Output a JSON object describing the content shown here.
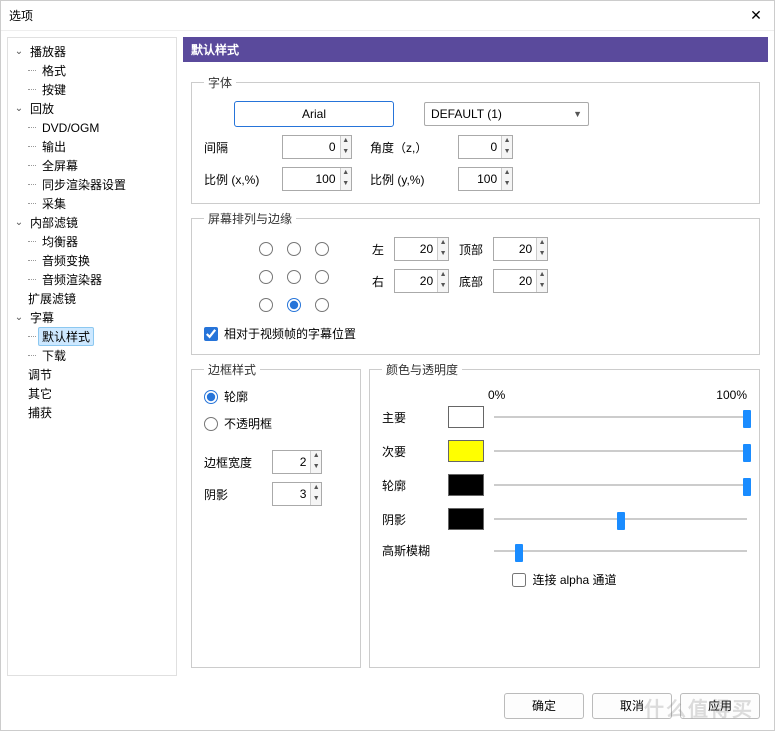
{
  "window": {
    "title": "选项",
    "close": "✕"
  },
  "tree": {
    "items": [
      {
        "label": "播放器",
        "exp": true,
        "children": [
          "格式",
          "按键"
        ]
      },
      {
        "label": "回放",
        "exp": true,
        "children": [
          "DVD/OGM",
          "输出",
          "全屏幕",
          "同步渲染器设置",
          "采集"
        ]
      },
      {
        "label": "内部滤镜",
        "exp": true,
        "children": [
          "均衡器",
          "音频变换",
          "音频渲染器"
        ]
      },
      {
        "label": "扩展滤镜",
        "exp": false,
        "children": []
      },
      {
        "label": "字幕",
        "exp": true,
        "children": [
          "默认样式",
          "下载"
        ],
        "selected": "默认样式"
      },
      {
        "label": "调节",
        "exp": false,
        "children": []
      },
      {
        "label": "其它",
        "exp": false,
        "children": []
      },
      {
        "label": "捕获",
        "exp": false,
        "children": []
      }
    ]
  },
  "panel": {
    "header": "默认样式",
    "font": {
      "legend": "字体",
      "font_button": "Arial",
      "default_combo": "DEFAULT (1)",
      "spacing_label": "间隔",
      "spacing_value": "0",
      "angle_label": "角度（z,）",
      "angle_value": "0",
      "scalex_label": "比例 (x,%)",
      "scalex_value": "100",
      "scaley_label": "比例 (y,%)",
      "scaley_value": "100"
    },
    "align": {
      "legend": "屏幕排列与边缘",
      "selected": 7,
      "left_label": "左",
      "left_value": "20",
      "right_label": "右",
      "right_value": "20",
      "top_label": "顶部",
      "top_value": "20",
      "bottom_label": "底部",
      "bottom_value": "20",
      "relative_checked": true,
      "relative_label": "相对于视频帧的字幕位置"
    },
    "border": {
      "legend": "边框样式",
      "outline_label": "轮廓",
      "outline_checked": true,
      "opaque_label": "不透明框",
      "width_label": "边框宽度",
      "width_value": "2",
      "shadow_label": "阴影",
      "shadow_value": "3"
    },
    "color": {
      "legend": "颜色与透明度",
      "pct0": "0%",
      "pct100": "100%",
      "primary_label": "主要",
      "primary_color": "#ffffff",
      "primary_pct": 100,
      "secondary_label": "次要",
      "secondary_color": "#ffff00",
      "secondary_pct": 100,
      "outline_label": "轮廓",
      "outline_color": "#000000",
      "outline_pct": 100,
      "shadow_label": "阴影",
      "shadow_color": "#000000",
      "shadow_pct": 50,
      "blur_label": "高斯模糊",
      "blur_pct": 10,
      "link_label": "连接 alpha 通道",
      "link_checked": false
    }
  },
  "footer": {
    "ok": "确定",
    "cancel": "取消",
    "apply": "应用"
  },
  "watermark": "什么值得买"
}
